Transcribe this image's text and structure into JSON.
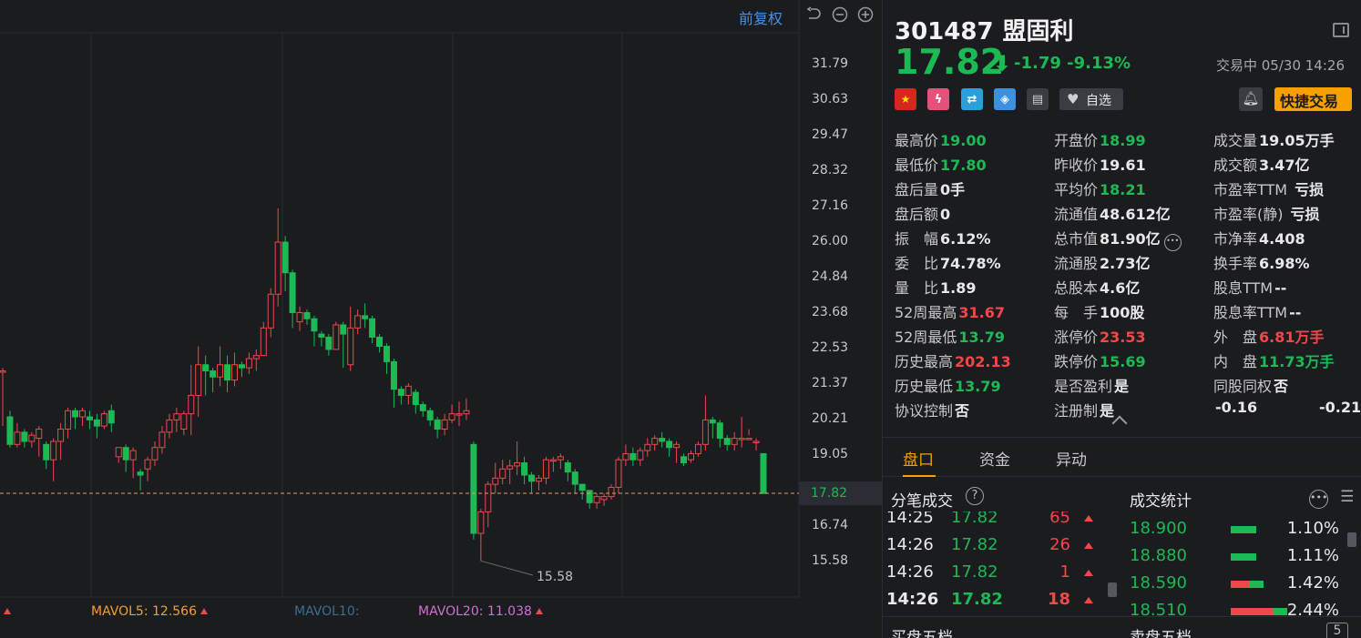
{
  "chart": {
    "fq_label": "前复权",
    "price_ticks": [
      "31.79",
      "30.63",
      "29.47",
      "28.32",
      "27.16",
      "26.00",
      "24.84",
      "23.68",
      "22.53",
      "21.37",
      "20.21",
      "19.05",
      "17.82",
      "16.74",
      "15.58"
    ],
    "current_price_tag": "17.82",
    "low_marker": "15.58",
    "mavol5_label": "MAVOL5:",
    "mavol5_value": "12.566",
    "mavol10_label": "MAVOL10:",
    "mavol20_label": "MAVOL20:",
    "mavol20_value": "11.038",
    "up_color": "#f04848",
    "down_color": "#1db954",
    "candles": [
      [
        21.8,
        21.8,
        20.3,
        20.0,
        21.9
      ],
      [
        20.3,
        19.4,
        19.0,
        19.3,
        20.5
      ],
      [
        19.4,
        19.8,
        19.0,
        19.3,
        20.1
      ],
      [
        19.8,
        19.5,
        18.9,
        19.3,
        19.9
      ],
      [
        19.5,
        19.7,
        19.3,
        19.3,
        19.8
      ],
      [
        19.6,
        19.9,
        19.1,
        19.0,
        20.0
      ],
      [
        19.4,
        18.9,
        18.5,
        18.6,
        19.5
      ],
      [
        18.9,
        19.5,
        18.4,
        18.2,
        19.6
      ],
      [
        19.5,
        19.9,
        19.0,
        18.9,
        20.1
      ],
      [
        19.9,
        20.5,
        19.8,
        19.6,
        20.6
      ],
      [
        20.5,
        20.3,
        20.0,
        19.9,
        20.6
      ],
      [
        20.3,
        20.5,
        20.1,
        20.0,
        20.6
      ],
      [
        20.3,
        20.2,
        20.0,
        19.9,
        20.5
      ],
      [
        20.2,
        20.0,
        19.7,
        19.6,
        20.4
      ],
      [
        20.0,
        20.4,
        20.0,
        19.9,
        20.5
      ],
      [
        20.5,
        20.1,
        19.9,
        19.8,
        20.7
      ],
      [
        19.0,
        19.3,
        18.9,
        18.8,
        19.3
      ],
      [
        19.3,
        18.9,
        18.6,
        18.5,
        19.4
      ],
      [
        18.9,
        19.2,
        18.4,
        18.3,
        19.3
      ],
      [
        18.5,
        18.4,
        18.1,
        17.9,
        18.6
      ],
      [
        18.6,
        18.9,
        18.3,
        18.2,
        19.0
      ],
      [
        18.9,
        19.3,
        18.8,
        18.7,
        19.5
      ],
      [
        19.3,
        19.8,
        19.2,
        19.1,
        20.0
      ],
      [
        19.8,
        20.2,
        19.7,
        19.6,
        20.4
      ],
      [
        20.2,
        20.4,
        19.9,
        19.8,
        20.6
      ],
      [
        19.9,
        20.4,
        19.8,
        19.7,
        20.5
      ],
      [
        20.4,
        21.0,
        19.8,
        19.7,
        22.0
      ],
      [
        21.0,
        22.0,
        20.4,
        20.3,
        22.6
      ],
      [
        22.0,
        21.8,
        21.1,
        21.0,
        22.3
      ],
      [
        21.8,
        21.6,
        21.2,
        21.1,
        21.9
      ],
      [
        21.6,
        22.0,
        21.4,
        21.3,
        22.6
      ],
      [
        22.0,
        21.5,
        21.2,
        21.1,
        22.3
      ],
      [
        21.5,
        22.0,
        21.4,
        21.3,
        22.4
      ],
      [
        22.0,
        21.9,
        21.7,
        21.6,
        22.1
      ],
      [
        21.9,
        22.2,
        21.8,
        21.7,
        22.4
      ],
      [
        22.2,
        22.3,
        21.9,
        21.8,
        22.5
      ],
      [
        22.3,
        23.2,
        22.6,
        22.5,
        23.4
      ],
      [
        23.2,
        24.3,
        23.0,
        22.9,
        24.5
      ],
      [
        24.3,
        26.0,
        24.0,
        23.9,
        27.1
      ],
      [
        26.0,
        25.0,
        24.5,
        24.4,
        26.2
      ],
      [
        25.0,
        23.7,
        23.3,
        23.2,
        25.1
      ],
      [
        23.4,
        23.7,
        23.2,
        23.1,
        23.9
      ],
      [
        23.7,
        23.5,
        23.4,
        23.3,
        23.8
      ],
      [
        23.5,
        23.1,
        22.7,
        22.6,
        23.6
      ],
      [
        23.0,
        22.9,
        22.7,
        22.6,
        23.1
      ],
      [
        22.9,
        22.5,
        22.4,
        22.3,
        23.0
      ],
      [
        22.5,
        23.3,
        22.7,
        22.6,
        23.4
      ],
      [
        23.3,
        23.0,
        22.0,
        21.9,
        23.4
      ],
      [
        22.0,
        23.2,
        21.9,
        21.8,
        23.9
      ],
      [
        23.2,
        23.6,
        23.1,
        23.0,
        23.8
      ],
      [
        23.6,
        23.5,
        23.3,
        23.2,
        24.0
      ],
      [
        23.5,
        22.9,
        22.8,
        22.7,
        23.6
      ],
      [
        22.9,
        22.6,
        22.5,
        22.4,
        23.0
      ],
      [
        22.6,
        22.1,
        21.8,
        21.7,
        22.7
      ],
      [
        22.1,
        21.2,
        20.9,
        20.6,
        22.2
      ],
      [
        21.2,
        21.0,
        20.8,
        20.7,
        21.3
      ],
      [
        21.0,
        21.3,
        20.8,
        20.7,
        21.4
      ],
      [
        21.1,
        20.7,
        20.5,
        20.4,
        21.2
      ],
      [
        20.7,
        20.5,
        20.4,
        20.3,
        20.8
      ],
      [
        20.5,
        20.2,
        20.1,
        20.0,
        20.6
      ],
      [
        20.2,
        19.9,
        19.8,
        19.6,
        20.3
      ],
      [
        19.9,
        20.2,
        19.8,
        19.7,
        20.4
      ],
      [
        20.2,
        20.4,
        20.2,
        20.1,
        20.7
      ],
      [
        20.4,
        20.4,
        20.1,
        20.0,
        20.8
      ],
      [
        20.4,
        20.5,
        20.3,
        20.2,
        20.9
      ],
      [
        19.4,
        16.5,
        16.4,
        16.3,
        19.5
      ],
      [
        16.5,
        17.2,
        16.3,
        15.6,
        17.3
      ],
      [
        17.2,
        18.1,
        16.8,
        16.7,
        18.2
      ],
      [
        18.1,
        18.3,
        17.9,
        17.8,
        18.8
      ],
      [
        18.3,
        18.6,
        18.2,
        18.1,
        18.9
      ],
      [
        18.6,
        18.7,
        18.2,
        18.1,
        18.9
      ],
      [
        18.7,
        18.8,
        18.5,
        18.4,
        19.5
      ],
      [
        18.8,
        18.4,
        18.2,
        18.1,
        19.0
      ],
      [
        18.4,
        18.2,
        17.9,
        17.8,
        18.5
      ],
      [
        18.2,
        18.3,
        18.0,
        17.9,
        18.4
      ],
      [
        18.3,
        18.9,
        18.2,
        18.1,
        19.0
      ],
      [
        18.9,
        18.9,
        18.6,
        18.5,
        19.0
      ],
      [
        18.9,
        19.0,
        18.7,
        18.6,
        19.1
      ],
      [
        18.8,
        18.5,
        18.3,
        18.2,
        18.9
      ],
      [
        18.5,
        18.1,
        17.9,
        17.8,
        18.6
      ],
      [
        18.1,
        17.9,
        17.7,
        17.6,
        18.0
      ],
      [
        17.9,
        17.5,
        17.4,
        17.3,
        17.9
      ],
      [
        17.5,
        17.7,
        17.4,
        17.3,
        17.8
      ],
      [
        17.6,
        17.7,
        17.5,
        17.4,
        17.8
      ],
      [
        17.7,
        18.0,
        17.7,
        17.6,
        18.1
      ],
      [
        18.0,
        18.9,
        17.9,
        17.8,
        19.0
      ],
      [
        18.9,
        19.1,
        18.8,
        18.7,
        19.4
      ],
      [
        19.1,
        18.9,
        18.8,
        18.7,
        19.3
      ],
      [
        18.9,
        19.2,
        18.8,
        18.7,
        19.3
      ],
      [
        19.2,
        19.4,
        19.1,
        19.0,
        19.6
      ],
      [
        19.4,
        19.6,
        19.3,
        19.2,
        19.7
      ],
      [
        19.6,
        19.5,
        19.4,
        19.3,
        19.8
      ],
      [
        19.5,
        19.3,
        19.1,
        19.0,
        19.6
      ],
      [
        19.3,
        19.4,
        18.9,
        18.8,
        19.5
      ],
      [
        19.0,
        18.8,
        18.8,
        18.7,
        19.1
      ],
      [
        18.9,
        19.1,
        18.9,
        18.8,
        19.2
      ],
      [
        19.1,
        19.4,
        19.1,
        19.0,
        19.5
      ],
      [
        19.4,
        20.2,
        19.3,
        19.2,
        21.0
      ],
      [
        20.2,
        20.1,
        19.7,
        19.6,
        20.3
      ],
      [
        20.1,
        19.6,
        19.4,
        19.3,
        20.2
      ],
      [
        19.6,
        19.4,
        19.3,
        19.2,
        19.7
      ],
      [
        19.4,
        19.6,
        19.3,
        19.2,
        19.8
      ],
      [
        19.6,
        19.6,
        19.4,
        19.3,
        20.3
      ],
      [
        19.6,
        19.6,
        19.8,
        19.7,
        19.9
      ],
      [
        19.5,
        19.5,
        19.2,
        19.2,
        19.6
      ],
      [
        19.1,
        17.8,
        17.8,
        17.8,
        19.1
      ]
    ]
  },
  "header": {
    "code": "301487",
    "name": "盟固利",
    "price": "17.82",
    "change": "-1.79",
    "change_pct": "-9.13%",
    "trade_time": "交易中 05/30 14:26",
    "watch_label": "自选",
    "quick_trade_label": "快捷交易"
  },
  "quote": {
    "col1": [
      {
        "label": "最高价",
        "value": "19.00",
        "color": "dn"
      },
      {
        "label": "最低价",
        "value": "17.80",
        "color": "dn"
      },
      {
        "label": "盘后量",
        "value": "0手",
        "color": "wh"
      },
      {
        "label": "盘后额",
        "value": "0",
        "color": "wh"
      },
      {
        "label": "振　幅",
        "value": "6.12%",
        "color": "wh"
      },
      {
        "label": "委　比",
        "value": "74.78%",
        "color": "wh"
      },
      {
        "label": "量　比",
        "value": "1.89",
        "color": "wh"
      },
      {
        "label": "52周最高",
        "value": "31.67",
        "color": "up"
      },
      {
        "label": "52周最低",
        "value": "13.79",
        "color": "dn"
      },
      {
        "label": "历史最高",
        "value": "202.13",
        "color": "up"
      },
      {
        "label": "历史最低",
        "value": "13.79",
        "color": "dn"
      },
      {
        "label": "协议控制",
        "value": "否",
        "color": "wh"
      }
    ],
    "col2": [
      {
        "label": "开盘价",
        "value": "18.99",
        "color": "dn"
      },
      {
        "label": "昨收价",
        "value": "19.61",
        "color": "wh"
      },
      {
        "label": "平均价",
        "value": "18.21",
        "color": "dn"
      },
      {
        "label": "流通值",
        "value": "48.612亿",
        "color": "wh"
      },
      {
        "label": "总市值",
        "value": "81.90亿",
        "color": "wh"
      },
      {
        "label": "流通股",
        "value": "2.73亿",
        "color": "wh"
      },
      {
        "label": "总股本",
        "value": "4.6亿",
        "color": "wh"
      },
      {
        "label": "每　手",
        "value": "100股",
        "color": "wh"
      },
      {
        "label": "涨停价",
        "value": "23.53",
        "color": "up"
      },
      {
        "label": "跌停价",
        "value": "15.69",
        "color": "dn"
      },
      {
        "label": "是否盈利",
        "value": "是",
        "color": "wh"
      },
      {
        "label": "注册制",
        "value": "是",
        "color": "wh"
      }
    ],
    "col3": [
      {
        "label": "成交量",
        "value": "19.05万手",
        "color": "wh"
      },
      {
        "label": "成交额",
        "value": "3.47亿",
        "color": "wh"
      },
      {
        "label": "市盈率TTM",
        "value": "亏损",
        "color": "wh"
      },
      {
        "label": "市盈率(静)",
        "value": "亏损",
        "color": "wh"
      },
      {
        "label": "市净率",
        "value": "4.408",
        "color": "wh"
      },
      {
        "label": "换手率",
        "value": "6.98%",
        "color": "wh"
      },
      {
        "label": "股息TTM",
        "value": "--",
        "color": "wh"
      },
      {
        "label": "股息率TTM",
        "value": "--",
        "color": "wh"
      },
      {
        "label": "外　盘",
        "value": "6.81万手",
        "color": "up"
      },
      {
        "label": "内　盘",
        "value": "11.73万手",
        "color": "dn"
      },
      {
        "label": "同股同权",
        "value": "否",
        "color": "wh"
      },
      {
        "label": "-0.16",
        "value": "-0.21",
        "color": "wh"
      }
    ]
  },
  "tabs": [
    "盘口",
    "资金",
    "异动"
  ],
  "ticks": {
    "title": "分笔成交",
    "rows": [
      {
        "time": "14:25",
        "price": "17.82",
        "vol": "65"
      },
      {
        "time": "14:26",
        "price": "17.82",
        "vol": "26"
      },
      {
        "time": "14:26",
        "price": "17.82",
        "vol": "1"
      },
      {
        "time": "14:26",
        "price": "17.82",
        "vol": "18"
      }
    ]
  },
  "stats": {
    "title": "成交统计",
    "rows": [
      {
        "price": "18.900",
        "pct": "1.10%",
        "pct_value": 1.1
      },
      {
        "price": "18.880",
        "pct": "1.11%",
        "pct_value": 1.11
      },
      {
        "price": "18.590",
        "pct": "1.42%",
        "pct_value": 1.42
      },
      {
        "price": "18.510",
        "pct": "2.44%",
        "pct_value": 2.44
      }
    ]
  },
  "bottom": {
    "buy5": "买盘五档",
    "sell5": "卖盘五档",
    "five": "5"
  },
  "icons": [
    "flag-cn-icon",
    "lightning-icon",
    "shuffle-icon",
    "tag-icon",
    "doc-icon",
    "heart-icon",
    "bell-icon",
    "undo-icon",
    "zoom-out-icon",
    "zoom-in-icon",
    "layout-icon",
    "help-icon",
    "more-icon",
    "list-icon"
  ]
}
